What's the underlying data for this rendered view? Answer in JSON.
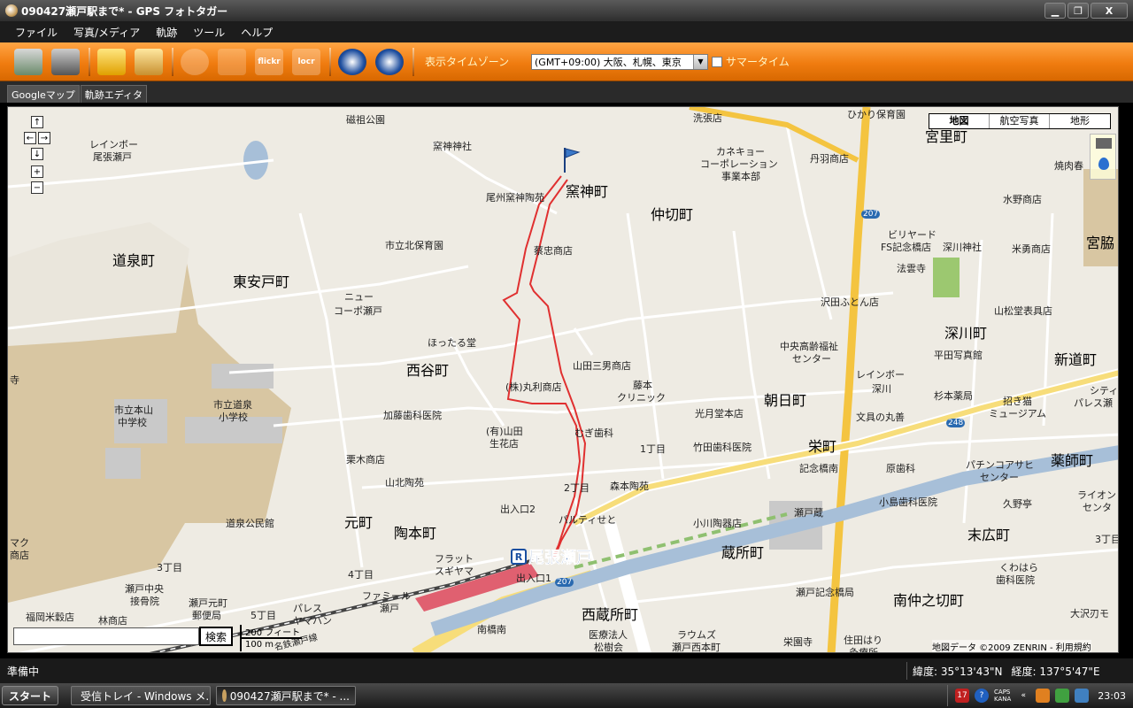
{
  "window": {
    "title": "090427瀬戸駅まで* - GPS フォトタガー",
    "minimize_label": "▁",
    "restore_label": "❐",
    "close_label": "X"
  },
  "menu": [
    "ファイル",
    "写真/メディア",
    "軌跡",
    "ツール",
    "ヘルプ"
  ],
  "toolbar": {
    "icons": [
      "import-photos-icon",
      "gps-device-icon",
      "folder-photos-icon",
      "photo-icon",
      "save-disk-icon",
      "edit-pen-icon",
      "flickr-icon",
      "locr-icon",
      "google-earth-icon",
      "movie-export-icon"
    ],
    "flickr_label": "flickr",
    "locr_label": "locr",
    "timezone_label": "表示タイムゾーン",
    "timezone_value": "(GMT+09:00) 大阪、札幌、東京",
    "summer_time_label": "サマータイム",
    "accent_color": "#f07c10"
  },
  "tabs": [
    {
      "label": "Googleマップ",
      "active": true
    },
    {
      "label": "軌跡エディタ",
      "active": false
    }
  ],
  "map": {
    "type_buttons": [
      "地図",
      "航空写真",
      "地形"
    ],
    "selected_type": "地図",
    "search_button": "検索",
    "search_value": "",
    "scale_ft": "200 フィート",
    "scale_m": "100 m",
    "copyright": "地図データ ©2009 ZENRIN - 利用規約",
    "station_name": "尾張瀬戸",
    "station_mark": "R",
    "route_color": "#e03030",
    "labels": {
      "l1": "道泉町",
      "l2": "東安戸町",
      "l3": "西谷町",
      "l4": "窯神町",
      "l5": "仲切町",
      "l6": "宮里町",
      "l7": "深川町",
      "l8": "新道町",
      "l9": "朝日町",
      "l10": "栄町",
      "l11": "薬師町",
      "l12": "元町",
      "l13": "陶本町",
      "l14": "蔵所町",
      "l15": "西蔵所町",
      "l16": "南仲之切町",
      "l17": "末広町",
      "l18": "宮脇",
      "s1": "磁祖公園",
      "s2": "窯神神社",
      "s3": "尾州窯神陶苑",
      "s4": "市立北保育園",
      "s5": "蔡忠商店",
      "s6": "ニュー",
      "s7": "コーポ瀬戸",
      "s8": "ほったる堂",
      "s9": "山田三男商店",
      "s10": "(株)丸利商店",
      "s11": "藤本",
      "s12": "クリニック",
      "s13": "加藤歯科医院",
      "s14": "(有)山田",
      "s15": "生花店",
      "s16": "むぎ歯科",
      "s17": "光月堂本店",
      "s18": "竹田歯科医院",
      "s19": "栗木商店",
      "s20": "山北陶苑",
      "s21": "森本陶苑",
      "s22": "市立本山",
      "s23": "中学校",
      "s24": "市立道泉",
      "s25": "小学校",
      "s26": "道泉公民館",
      "s27": "レインボー",
      "s28": "尾張瀬戸",
      "s29": "カネキョー",
      "s30": "コーポレーション",
      "s31": "事業本部",
      "s32": "丹羽商店",
      "s33": "ひかり保育園",
      "s34": "洗張店",
      "s35": "ビリヤード",
      "s36": "FS記念橋店",
      "s37": "深川神社",
      "s38": "法雲寺",
      "s39": "米勇商店",
      "s40": "水野商店",
      "s41": "焼肉春",
      "s42": "沢田ふとん店",
      "s43": "山松堂表具店",
      "s44": "中央高齢福祉",
      "s45": "センター",
      "s46": "平田写真館",
      "s47": "レインボー",
      "s48": "深川",
      "s49": "杉本薬局",
      "s50": "招き猫",
      "s51": "ミュージアム",
      "s52": "文具の丸善",
      "s53": "記念橋南",
      "s54": "原歯科",
      "s55": "パチンコアサヒ",
      "s56": "センター",
      "s57": "小島歯科医院",
      "s58": "久野亭",
      "s59": "瀬戸蔵",
      "s60": "小川陶器店",
      "s61": "パルティせと",
      "s62": "出入口2",
      "s63": "出入口1",
      "s64": "フラット",
      "s65": "スギヤマ",
      "s66": "ファミール",
      "s67": "瀬戸",
      "s68": "パレス",
      "s69": "ヤマハン",
      "s70": "南橋南",
      "s71": "医療法人",
      "s72": "松樹会",
      "s73": "ラウムズ",
      "s74": "瀬戸西本町",
      "s75": "瀬戸記念橋局",
      "s76": "住田はり",
      "s77": "灸療所",
      "s78": "栄園寺",
      "s79": "くわはら",
      "s80": "歯科医院",
      "s81": "大沢刃モ",
      "s82": "シティ",
      "s83": "パレス瀬",
      "s84": "ライオン",
      "s85": "センタ",
      "s86": "瀬戸中央",
      "s87": "接骨院",
      "s88": "瀬戸元町",
      "s89": "郵便局",
      "s90": "福岡米穀店",
      "s91": "林商店",
      "s92": "マク",
      "s93": "商店",
      "s94": "寺",
      "s95": "3丁目",
      "s96": "4丁目",
      "s97": "5丁目",
      "s98": "2丁目",
      "s99": "1丁目",
      "s100": "3丁目",
      "s101": "207",
      "s102": "207",
      "s103": "248",
      "s104": "名鉄瀬戸線"
    }
  },
  "status": {
    "left": "準備中",
    "lat": "緯度: 35°13'43\"N",
    "lon": "経度: 137°5'47\"E"
  },
  "taskbar": {
    "start": "スタート",
    "tasks": [
      {
        "label": "受信トレイ - Windows メ...",
        "active": false
      },
      {
        "label": "090427瀬戸駅まで* - ...",
        "active": true
      }
    ],
    "caps": "CAPS",
    "kana": "KANA",
    "tray_badge": "17",
    "clock": "23:03"
  }
}
